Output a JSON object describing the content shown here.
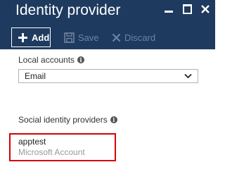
{
  "window": {
    "title": "Identity provider"
  },
  "toolbar": {
    "add_label": "Add",
    "save_label": "Save",
    "discard_label": "Discard"
  },
  "local_accounts": {
    "label": "Local accounts",
    "selected": "Email"
  },
  "social_identity_providers": {
    "label": "Social identity providers",
    "items": [
      {
        "name": "apptest",
        "type": "Microsoft Account"
      }
    ]
  },
  "colors": {
    "header_bg": "#1e3a5f",
    "highlight_border": "#d70000"
  }
}
